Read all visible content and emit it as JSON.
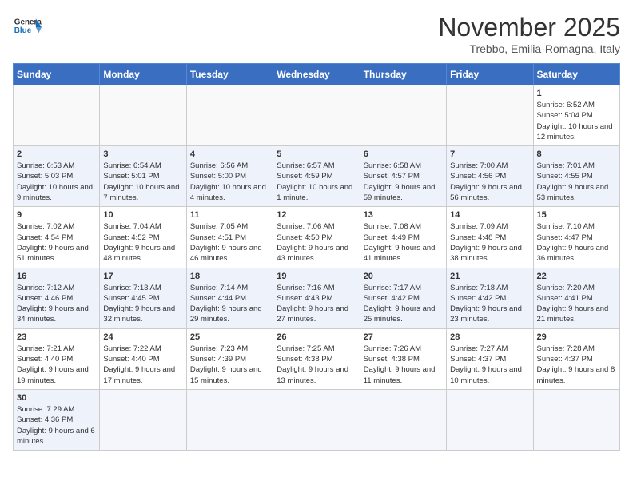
{
  "header": {
    "logo_general": "General",
    "logo_blue": "Blue",
    "month_title": "November 2025",
    "location": "Trebbo, Emilia-Romagna, Italy"
  },
  "weekdays": [
    "Sunday",
    "Monday",
    "Tuesday",
    "Wednesday",
    "Thursday",
    "Friday",
    "Saturday"
  ],
  "weeks": [
    [
      {
        "day": "",
        "info": ""
      },
      {
        "day": "",
        "info": ""
      },
      {
        "day": "",
        "info": ""
      },
      {
        "day": "",
        "info": ""
      },
      {
        "day": "",
        "info": ""
      },
      {
        "day": "",
        "info": ""
      },
      {
        "day": "1",
        "info": "Sunrise: 6:52 AM\nSunset: 5:04 PM\nDaylight: 10 hours and 12 minutes."
      }
    ],
    [
      {
        "day": "2",
        "info": "Sunrise: 6:53 AM\nSunset: 5:03 PM\nDaylight: 10 hours and 9 minutes."
      },
      {
        "day": "3",
        "info": "Sunrise: 6:54 AM\nSunset: 5:01 PM\nDaylight: 10 hours and 7 minutes."
      },
      {
        "day": "4",
        "info": "Sunrise: 6:56 AM\nSunset: 5:00 PM\nDaylight: 10 hours and 4 minutes."
      },
      {
        "day": "5",
        "info": "Sunrise: 6:57 AM\nSunset: 4:59 PM\nDaylight: 10 hours and 1 minute."
      },
      {
        "day": "6",
        "info": "Sunrise: 6:58 AM\nSunset: 4:57 PM\nDaylight: 9 hours and 59 minutes."
      },
      {
        "day": "7",
        "info": "Sunrise: 7:00 AM\nSunset: 4:56 PM\nDaylight: 9 hours and 56 minutes."
      },
      {
        "day": "8",
        "info": "Sunrise: 7:01 AM\nSunset: 4:55 PM\nDaylight: 9 hours and 53 minutes."
      }
    ],
    [
      {
        "day": "9",
        "info": "Sunrise: 7:02 AM\nSunset: 4:54 PM\nDaylight: 9 hours and 51 minutes."
      },
      {
        "day": "10",
        "info": "Sunrise: 7:04 AM\nSunset: 4:52 PM\nDaylight: 9 hours and 48 minutes."
      },
      {
        "day": "11",
        "info": "Sunrise: 7:05 AM\nSunset: 4:51 PM\nDaylight: 9 hours and 46 minutes."
      },
      {
        "day": "12",
        "info": "Sunrise: 7:06 AM\nSunset: 4:50 PM\nDaylight: 9 hours and 43 minutes."
      },
      {
        "day": "13",
        "info": "Sunrise: 7:08 AM\nSunset: 4:49 PM\nDaylight: 9 hours and 41 minutes."
      },
      {
        "day": "14",
        "info": "Sunrise: 7:09 AM\nSunset: 4:48 PM\nDaylight: 9 hours and 38 minutes."
      },
      {
        "day": "15",
        "info": "Sunrise: 7:10 AM\nSunset: 4:47 PM\nDaylight: 9 hours and 36 minutes."
      }
    ],
    [
      {
        "day": "16",
        "info": "Sunrise: 7:12 AM\nSunset: 4:46 PM\nDaylight: 9 hours and 34 minutes."
      },
      {
        "day": "17",
        "info": "Sunrise: 7:13 AM\nSunset: 4:45 PM\nDaylight: 9 hours and 32 minutes."
      },
      {
        "day": "18",
        "info": "Sunrise: 7:14 AM\nSunset: 4:44 PM\nDaylight: 9 hours and 29 minutes."
      },
      {
        "day": "19",
        "info": "Sunrise: 7:16 AM\nSunset: 4:43 PM\nDaylight: 9 hours and 27 minutes."
      },
      {
        "day": "20",
        "info": "Sunrise: 7:17 AM\nSunset: 4:42 PM\nDaylight: 9 hours and 25 minutes."
      },
      {
        "day": "21",
        "info": "Sunrise: 7:18 AM\nSunset: 4:42 PM\nDaylight: 9 hours and 23 minutes."
      },
      {
        "day": "22",
        "info": "Sunrise: 7:20 AM\nSunset: 4:41 PM\nDaylight: 9 hours and 21 minutes."
      }
    ],
    [
      {
        "day": "23",
        "info": "Sunrise: 7:21 AM\nSunset: 4:40 PM\nDaylight: 9 hours and 19 minutes."
      },
      {
        "day": "24",
        "info": "Sunrise: 7:22 AM\nSunset: 4:40 PM\nDaylight: 9 hours and 17 minutes."
      },
      {
        "day": "25",
        "info": "Sunrise: 7:23 AM\nSunset: 4:39 PM\nDaylight: 9 hours and 15 minutes."
      },
      {
        "day": "26",
        "info": "Sunrise: 7:25 AM\nSunset: 4:38 PM\nDaylight: 9 hours and 13 minutes."
      },
      {
        "day": "27",
        "info": "Sunrise: 7:26 AM\nSunset: 4:38 PM\nDaylight: 9 hours and 11 minutes."
      },
      {
        "day": "28",
        "info": "Sunrise: 7:27 AM\nSunset: 4:37 PM\nDaylight: 9 hours and 10 minutes."
      },
      {
        "day": "29",
        "info": "Sunrise: 7:28 AM\nSunset: 4:37 PM\nDaylight: 9 hours and 8 minutes."
      }
    ],
    [
      {
        "day": "30",
        "info": "Sunrise: 7:29 AM\nSunset: 4:36 PM\nDaylight: 9 hours and 6 minutes."
      },
      {
        "day": "",
        "info": ""
      },
      {
        "day": "",
        "info": ""
      },
      {
        "day": "",
        "info": ""
      },
      {
        "day": "",
        "info": ""
      },
      {
        "day": "",
        "info": ""
      },
      {
        "day": "",
        "info": ""
      }
    ]
  ]
}
